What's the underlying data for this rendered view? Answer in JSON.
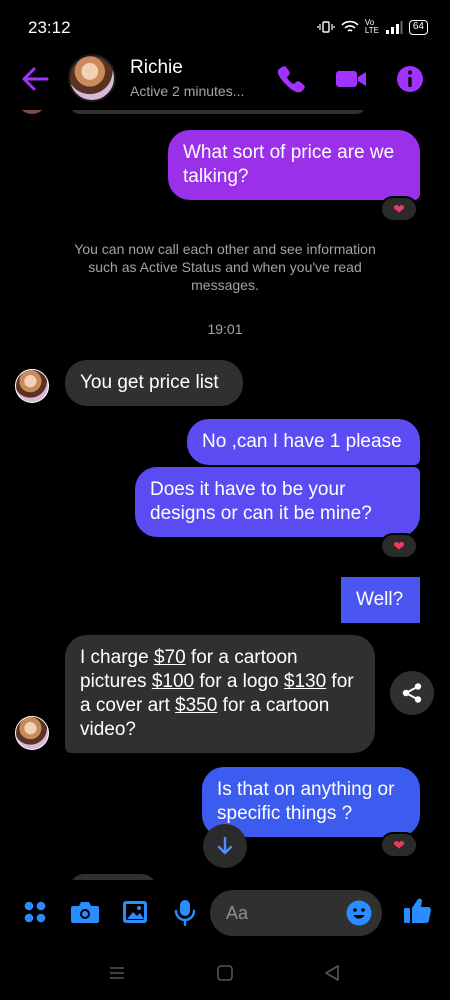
{
  "status_bar": {
    "time": "23:12",
    "signal_text": "Vo LTE",
    "battery": "64"
  },
  "header": {
    "contact_name": "Richie",
    "contact_status": "Active 2 minutes...",
    "accent_color": "#a033ff"
  },
  "messages": [
    {
      "id": "m1",
      "direction": "outgoing",
      "text": "What sort of price are we talking?",
      "reaction": "❤"
    },
    {
      "id": "m2",
      "direction": "incoming",
      "text": "You get price list"
    },
    {
      "id": "m3",
      "direction": "outgoing",
      "text": "No ,can I have 1 please"
    },
    {
      "id": "m4",
      "direction": "outgoing",
      "text": "Does it have to be your designs or can it be mine?",
      "reaction": "❤"
    },
    {
      "id": "m5",
      "direction": "outgoing",
      "text": "Well?"
    },
    {
      "id": "m6",
      "direction": "incoming",
      "parts": [
        "I charge ",
        "$70",
        " for a cartoon pictures ",
        "$100",
        " for a logo ",
        "$130",
        " for a cover art ",
        "$350",
        " for a cartoon video?"
      ]
    },
    {
      "id": "m7",
      "direction": "outgoing",
      "text": "Is that on anything or specific things ?",
      "reaction": "❤"
    }
  ],
  "system_note": "You can now call each other and see information such as Active Status and when you've read messages.",
  "timestamp": "19:01",
  "composer": {
    "placeholder": "Aa"
  },
  "icons": {
    "back": "arrow-left-icon",
    "call": "phone-icon",
    "video": "video-camera-icon",
    "info": "info-icon",
    "share": "share-icon",
    "scroll": "arrow-down-icon",
    "apps": "apps-grid-icon",
    "camera": "camera-icon",
    "gallery": "image-icon",
    "mic": "microphone-icon",
    "emoji": "smiley-icon",
    "like": "thumbs-up-icon"
  }
}
